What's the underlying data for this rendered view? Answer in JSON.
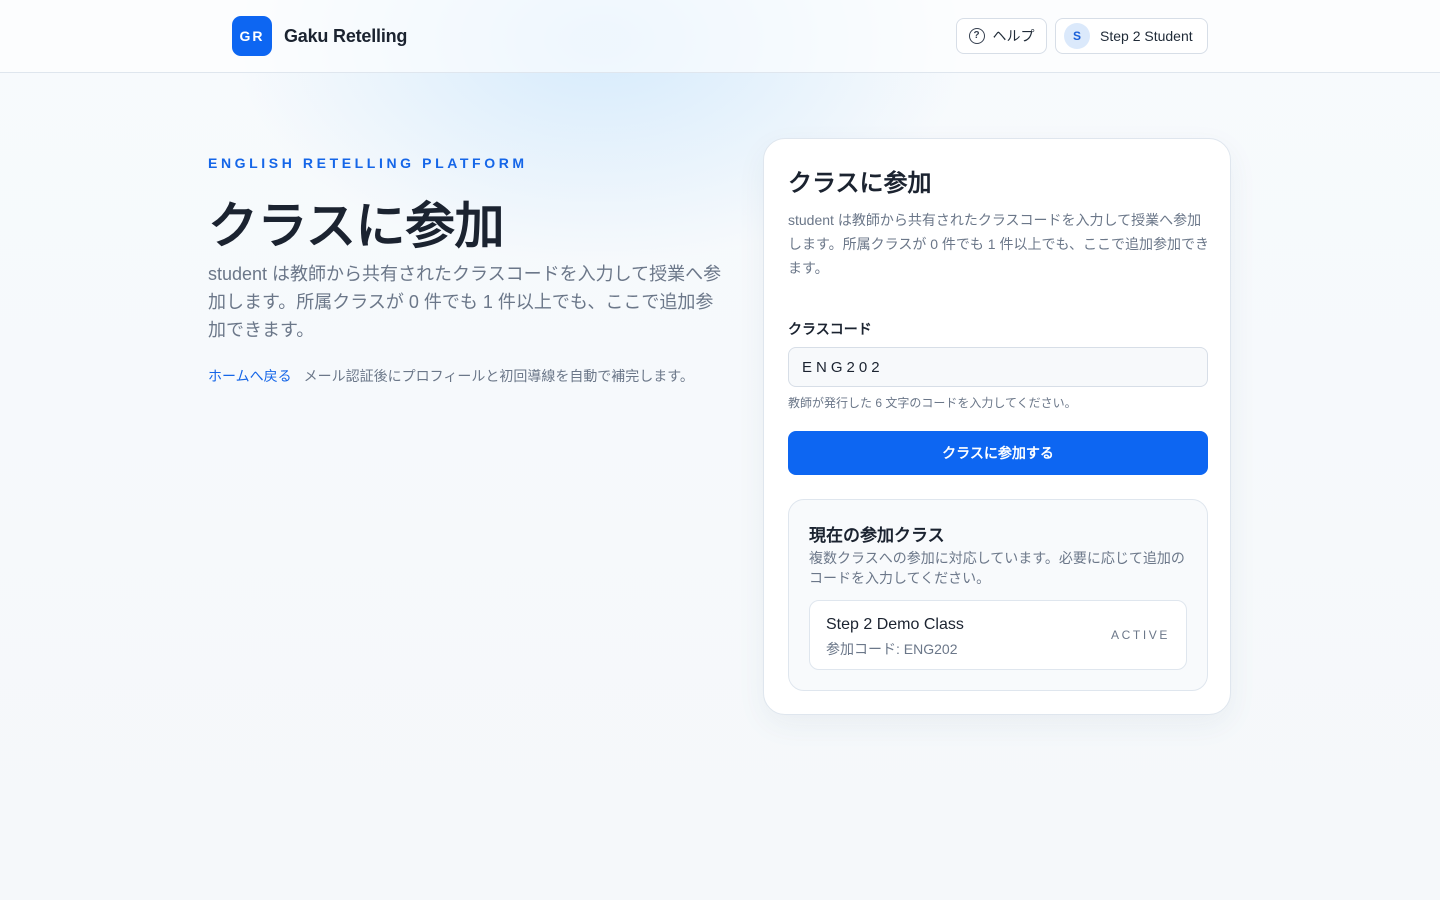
{
  "header": {
    "logo_text": "GR",
    "app_name": "Gaku Retelling",
    "help_label": "ヘルプ",
    "user_initial": "S",
    "user_name": "Step 2 Student"
  },
  "hero": {
    "eyebrow": "ENGLISH RETELLING PLATFORM",
    "title": "クラスに参加",
    "description": "student は教師から共有されたクラスコードを入力して授業へ参加します。所属クラスが 0 件でも 1 件以上でも、ここで追加参加できます。",
    "home_link": "ホームへ戻る",
    "note": "メール認証後にプロフィールと初回導線を自動で補完します。"
  },
  "join_card": {
    "title": "クラスに参加",
    "description": "student は教師から共有されたクラスコードを入力して授業へ参加します。所属クラスが 0 件でも 1 件以上でも、ここで追加参加できます。",
    "code_label": "クラスコード",
    "code_value": "ENG202",
    "code_hint": "教師が発行した 6 文字のコードを入力してください。",
    "submit_label": "クラスに参加する"
  },
  "current_classes": {
    "title": "現在の参加クラス",
    "description": "複数クラスへの参加に対応しています。必要に応じて追加のコードを入力してください。",
    "items": [
      {
        "name": "Step 2 Demo Class",
        "code": "参加コード: ENG202",
        "status": "ACTIVE"
      }
    ]
  },
  "colors": {
    "accent": "#0d66f2",
    "text": "#1b2330",
    "muted": "#6b7789"
  }
}
